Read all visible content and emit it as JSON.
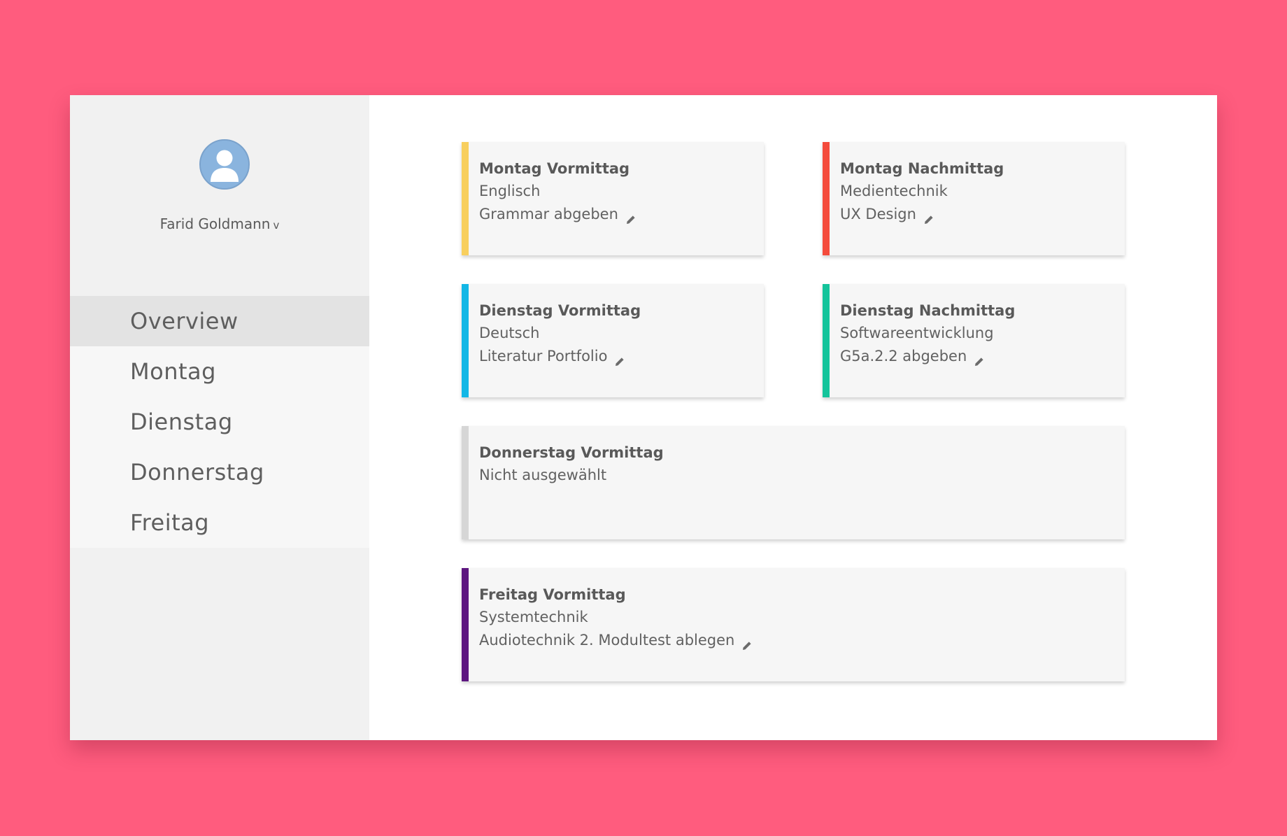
{
  "user": {
    "name": "Farid Goldmann",
    "chevron": "v"
  },
  "nav": {
    "items": [
      {
        "label": "Overview",
        "active": true
      },
      {
        "label": "Montag",
        "active": false
      },
      {
        "label": "Dienstag",
        "active": false
      },
      {
        "label": "Donnerstag",
        "active": false
      },
      {
        "label": "Freitag",
        "active": false
      }
    ]
  },
  "cards": [
    {
      "title": "Montag Vormittag",
      "subject": "Englisch",
      "task": "Grammar abgeben",
      "color": "#f8cf5e",
      "editable": true
    },
    {
      "title": "Montag Nachmittag",
      "subject": "Medientechnik",
      "task": "UX Design",
      "color": "#f44b3c",
      "editable": true
    },
    {
      "title": "Dienstag Vormittag",
      "subject": "Deutsch",
      "task": "Literatur Portfolio",
      "color": "#13b7e6",
      "editable": true
    },
    {
      "title": "Dienstag Nachmittag",
      "subject": "Softwareentwicklung",
      "task": "G5a.2.2 abgeben",
      "color": "#14c49b",
      "editable": true
    },
    {
      "title": "Donnerstag Vormittag",
      "subject": "Nicht ausgewählt",
      "task": "",
      "color": "#d6d6d6",
      "editable": false
    },
    {
      "title": "Freitag Vormittag",
      "subject": "Systemtechnik",
      "task": "Audiotechnik 2. Modultest ablegen",
      "color": "#5d1780",
      "editable": true
    }
  ],
  "icons": {
    "avatar": "user-avatar-icon",
    "edit": "pencil-icon",
    "dropdown": "chevron-down-icon"
  }
}
